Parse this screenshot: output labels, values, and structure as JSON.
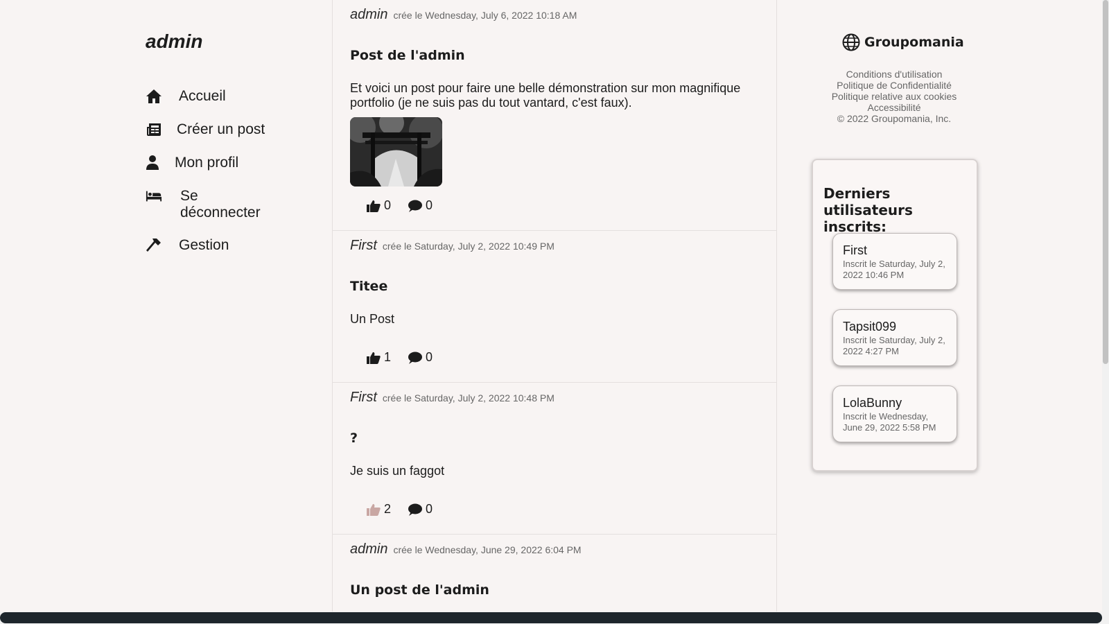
{
  "sidebar": {
    "username": "admin",
    "nav": [
      {
        "label": "Accueil",
        "icon": "home-icon"
      },
      {
        "label": "Créer un post",
        "icon": "newspaper-icon"
      },
      {
        "label": "Mon profil",
        "icon": "user-icon"
      },
      {
        "label": "Se déconnecter",
        "icon": "bed-icon"
      },
      {
        "label": "Gestion",
        "icon": "hammer-icon"
      }
    ]
  },
  "feed": {
    "posts": [
      {
        "author": "admin",
        "date": "crée le Wednesday, July 6, 2022 10:18 AM",
        "title": "Post de l'admin",
        "body": "Et voici un post pour faire une belle démonstration sur mon magnifique portfolio (je ne suis pas du tout vantard, c'est faux).",
        "has_image": true,
        "likes": "0",
        "comments": "0",
        "liked": false
      },
      {
        "author": "First",
        "date": "crée le Saturday, July 2, 2022 10:49 PM",
        "title": "Titee",
        "body": "Un Post",
        "likes": "1",
        "comments": "0",
        "liked": false
      },
      {
        "author": "First",
        "date": "crée le Saturday, July 2, 2022 10:48 PM",
        "title": "?",
        "body": "Je suis un faggot",
        "likes": "2",
        "comments": "0",
        "liked": true
      },
      {
        "author": "admin",
        "date": "crée le Wednesday, June 29, 2022 6:04 PM",
        "title": "Un post de l'admin"
      }
    ]
  },
  "right": {
    "brand": "Groupomania",
    "links": [
      "Conditions d'utilisation",
      "Politique de Confidentialité",
      "Politique relative aux cookies",
      "Accessibilité",
      "© 2022 Groupomania, Inc."
    ],
    "users_title": "Derniers utilisateurs inscrits:",
    "users": [
      {
        "name": "First",
        "since": "Inscrit le Saturday, July 2, 2022 10:46 PM"
      },
      {
        "name": "Tapsit099",
        "since": "Inscrit le Saturday, July 2, 2022 4:27 PM"
      },
      {
        "name": "LolaBunny",
        "since": "Inscrit le Wednesday, June 29, 2022 5:58 PM"
      }
    ]
  },
  "colors": {
    "background": "#f8f4f3",
    "text": "#1c1c1c",
    "liked_thumb": "#c9a7a3",
    "scroll_thumb": "#1e262c"
  }
}
